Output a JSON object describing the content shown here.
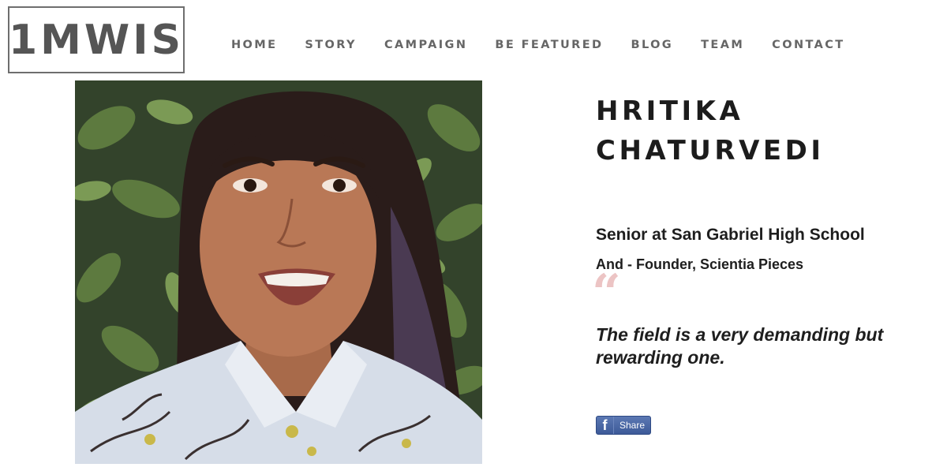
{
  "logo": {
    "text": "1MWIS"
  },
  "nav": [
    {
      "label": "HOME"
    },
    {
      "label": "STORY"
    },
    {
      "label": "CAMPAIGN"
    },
    {
      "label": "BE FEATURED"
    },
    {
      "label": "BLOG"
    },
    {
      "label": "TEAM"
    },
    {
      "label": "CONTACT"
    }
  ],
  "profile": {
    "name_line1": "HRITIKA",
    "name_line2": "CHATURVEDI",
    "role": "Senior at San Gabriel High School",
    "subtitle": "And - Founder, Scientia Pieces",
    "quote_mark": "“",
    "quote": "The field is a very demanding but rewarding one."
  },
  "share": {
    "label": "Share",
    "icon": "facebook-icon",
    "icon_glyph": "f"
  },
  "colors": {
    "nav": "#666666",
    "quote_mark": "#ecc4c4",
    "share_bg": "#3d5a98"
  }
}
